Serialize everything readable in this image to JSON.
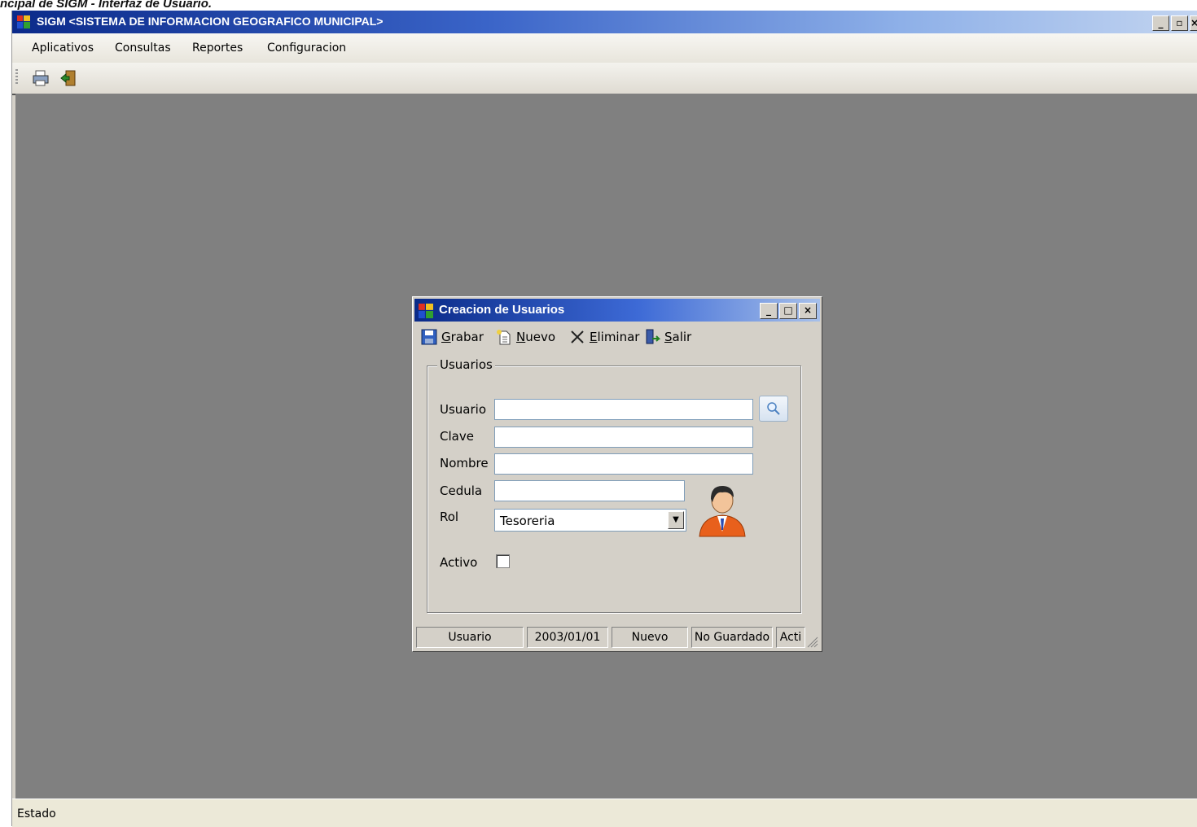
{
  "caption": "ncipal de SIGM - Interfaz de Usuario.",
  "app": {
    "title": "SIGM <SISTEMA DE INFORMACION GEOGRAFICO MUNICIPAL>",
    "menu": [
      "Aplicativos",
      "Consultas",
      "Reportes",
      "Configuracion"
    ],
    "toolbar_icons": [
      "print-icon",
      "exit-door-icon"
    ],
    "status": "Estado"
  },
  "dialog": {
    "title": "Creacion de Usuarios",
    "toolbar": [
      {
        "label": "Grabar",
        "accesskey": "G",
        "icon": "save-icon"
      },
      {
        "label": "Nuevo",
        "accesskey": "N",
        "icon": "new-document-icon"
      },
      {
        "label": "Eliminar",
        "accesskey": "E",
        "icon": "delete-x-icon"
      },
      {
        "label": "Salir",
        "accesskey": "S",
        "icon": "exit-icon"
      }
    ],
    "group_label": "Usuarios",
    "fields": {
      "usuario_label": "Usuario",
      "usuario_value": "",
      "clave_label": "Clave",
      "clave_value": "",
      "nombre_label": "Nombre",
      "nombre_value": "",
      "cedula_label": "Cedula",
      "cedula_value": "",
      "rol_label": "Rol",
      "rol_value": "Tesoreria",
      "activo_label": "Activo",
      "activo_checked": false
    },
    "status_panels": [
      "Usuario",
      "2003/01/01",
      "Nuevo",
      "No Guardado",
      "Acti"
    ]
  },
  "colors": {
    "desktop": "#808080",
    "title_start": "#0b2a8a",
    "window_face": "#d4d0c8"
  }
}
